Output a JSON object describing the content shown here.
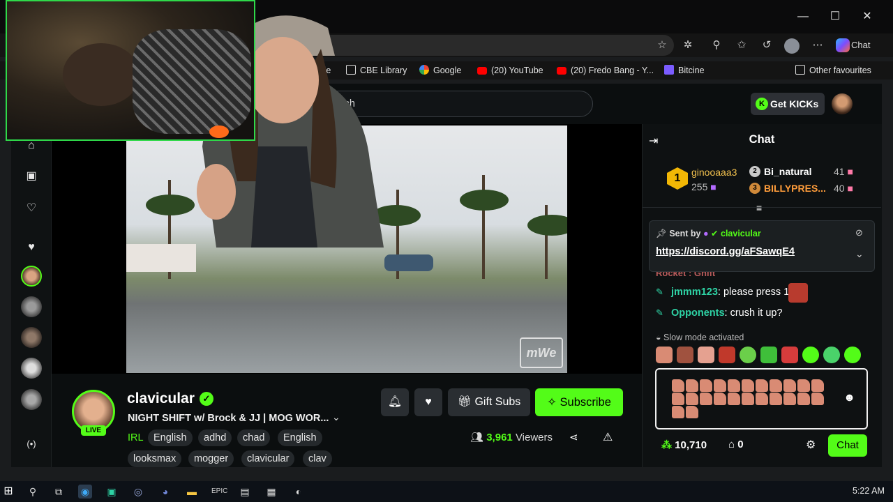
{
  "browser": {
    "window_controls": {
      "minimize": "—",
      "maximize": "☐",
      "close": "✕"
    },
    "address_fragment": "",
    "chat_label": "Chat",
    "bookmarks": [
      {
        "label": "nsite",
        "icon": "none"
      },
      {
        "label": "Google",
        "icon": "google-icon"
      },
      {
        "label": "CBE Library",
        "icon": "document-icon"
      },
      {
        "label": "Google",
        "icon": "google-icon"
      },
      {
        "label": "(20) YouTube",
        "icon": "youtube-icon"
      },
      {
        "label": "(20) Fredo Bang - Y...",
        "icon": "youtube-icon"
      },
      {
        "label": "Bitcine",
        "icon": "bitcine-icon"
      }
    ],
    "other_favourites": "Other favourites"
  },
  "kick": {
    "search_placeholder": "Search",
    "get_kicks": "Get KICKs",
    "channel": {
      "name": "clavicular",
      "live": "LIVE",
      "title": "NIGHT SHIFT w/ Brock & JJ | MOG WOR...",
      "category": "IRL",
      "tags": [
        "English",
        "adhd",
        "chad",
        "English",
        "looksmax",
        "mogger",
        "clavicular",
        "clav"
      ],
      "viewers_count": "3,961",
      "viewers_label": "Viewers"
    },
    "buttons": {
      "gift_subs": "Gift Subs",
      "subscribe": "Subscribe"
    },
    "watermark": "mWe"
  },
  "chat": {
    "title": "Chat",
    "leaderboard": {
      "first": {
        "rank": "1",
        "name": "ginooaaa3",
        "count": "255"
      },
      "second": {
        "rank": "2",
        "name": "Bi_natural",
        "count": "41"
      },
      "third": {
        "rank": "3",
        "name": "BILLYPRES...",
        "count": "40"
      }
    },
    "pinned": {
      "sent_by_label": "Sent by",
      "sender": "clavicular",
      "link": "https://discord.gg/aFSawqE4"
    },
    "partial_message": "Rocket : Gnift",
    "messages": [
      {
        "user": "jmmm123",
        "text": " please press 1",
        "color": "#2ed3a5"
      },
      {
        "user": "Opponents",
        "text": " crush it up?",
        "color": "#2ed3a5"
      }
    ],
    "slow_mode": "Slow mode activated",
    "points": "10,710",
    "store_count": "0",
    "send_label": "Chat"
  },
  "taskbar": {
    "time": "5:22 AM"
  },
  "colors": {
    "kick_green": "#53fc18",
    "cam_border": "#2fd94a"
  }
}
